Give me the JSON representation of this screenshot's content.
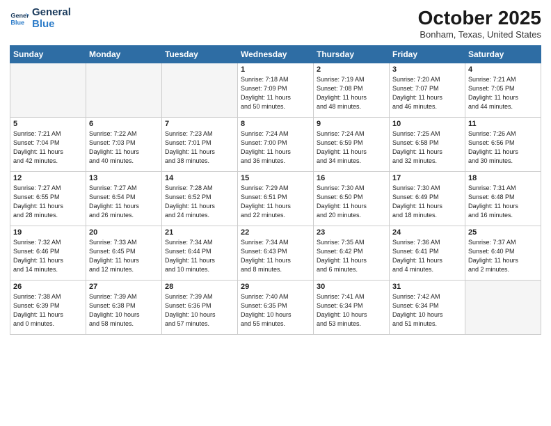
{
  "logo": {
    "line1": "General",
    "line2": "Blue"
  },
  "title": "October 2025",
  "location": "Bonham, Texas, United States",
  "weekdays": [
    "Sunday",
    "Monday",
    "Tuesday",
    "Wednesday",
    "Thursday",
    "Friday",
    "Saturday"
  ],
  "weeks": [
    [
      {
        "day": "",
        "info": ""
      },
      {
        "day": "",
        "info": ""
      },
      {
        "day": "",
        "info": ""
      },
      {
        "day": "1",
        "info": "Sunrise: 7:18 AM\nSunset: 7:09 PM\nDaylight: 11 hours\nand 50 minutes."
      },
      {
        "day": "2",
        "info": "Sunrise: 7:19 AM\nSunset: 7:08 PM\nDaylight: 11 hours\nand 48 minutes."
      },
      {
        "day": "3",
        "info": "Sunrise: 7:20 AM\nSunset: 7:07 PM\nDaylight: 11 hours\nand 46 minutes."
      },
      {
        "day": "4",
        "info": "Sunrise: 7:21 AM\nSunset: 7:05 PM\nDaylight: 11 hours\nand 44 minutes."
      }
    ],
    [
      {
        "day": "5",
        "info": "Sunrise: 7:21 AM\nSunset: 7:04 PM\nDaylight: 11 hours\nand 42 minutes."
      },
      {
        "day": "6",
        "info": "Sunrise: 7:22 AM\nSunset: 7:03 PM\nDaylight: 11 hours\nand 40 minutes."
      },
      {
        "day": "7",
        "info": "Sunrise: 7:23 AM\nSunset: 7:01 PM\nDaylight: 11 hours\nand 38 minutes."
      },
      {
        "day": "8",
        "info": "Sunrise: 7:24 AM\nSunset: 7:00 PM\nDaylight: 11 hours\nand 36 minutes."
      },
      {
        "day": "9",
        "info": "Sunrise: 7:24 AM\nSunset: 6:59 PM\nDaylight: 11 hours\nand 34 minutes."
      },
      {
        "day": "10",
        "info": "Sunrise: 7:25 AM\nSunset: 6:58 PM\nDaylight: 11 hours\nand 32 minutes."
      },
      {
        "day": "11",
        "info": "Sunrise: 7:26 AM\nSunset: 6:56 PM\nDaylight: 11 hours\nand 30 minutes."
      }
    ],
    [
      {
        "day": "12",
        "info": "Sunrise: 7:27 AM\nSunset: 6:55 PM\nDaylight: 11 hours\nand 28 minutes."
      },
      {
        "day": "13",
        "info": "Sunrise: 7:27 AM\nSunset: 6:54 PM\nDaylight: 11 hours\nand 26 minutes."
      },
      {
        "day": "14",
        "info": "Sunrise: 7:28 AM\nSunset: 6:52 PM\nDaylight: 11 hours\nand 24 minutes."
      },
      {
        "day": "15",
        "info": "Sunrise: 7:29 AM\nSunset: 6:51 PM\nDaylight: 11 hours\nand 22 minutes."
      },
      {
        "day": "16",
        "info": "Sunrise: 7:30 AM\nSunset: 6:50 PM\nDaylight: 11 hours\nand 20 minutes."
      },
      {
        "day": "17",
        "info": "Sunrise: 7:30 AM\nSunset: 6:49 PM\nDaylight: 11 hours\nand 18 minutes."
      },
      {
        "day": "18",
        "info": "Sunrise: 7:31 AM\nSunset: 6:48 PM\nDaylight: 11 hours\nand 16 minutes."
      }
    ],
    [
      {
        "day": "19",
        "info": "Sunrise: 7:32 AM\nSunset: 6:46 PM\nDaylight: 11 hours\nand 14 minutes."
      },
      {
        "day": "20",
        "info": "Sunrise: 7:33 AM\nSunset: 6:45 PM\nDaylight: 11 hours\nand 12 minutes."
      },
      {
        "day": "21",
        "info": "Sunrise: 7:34 AM\nSunset: 6:44 PM\nDaylight: 11 hours\nand 10 minutes."
      },
      {
        "day": "22",
        "info": "Sunrise: 7:34 AM\nSunset: 6:43 PM\nDaylight: 11 hours\nand 8 minutes."
      },
      {
        "day": "23",
        "info": "Sunrise: 7:35 AM\nSunset: 6:42 PM\nDaylight: 11 hours\nand 6 minutes."
      },
      {
        "day": "24",
        "info": "Sunrise: 7:36 AM\nSunset: 6:41 PM\nDaylight: 11 hours\nand 4 minutes."
      },
      {
        "day": "25",
        "info": "Sunrise: 7:37 AM\nSunset: 6:40 PM\nDaylight: 11 hours\nand 2 minutes."
      }
    ],
    [
      {
        "day": "26",
        "info": "Sunrise: 7:38 AM\nSunset: 6:39 PM\nDaylight: 11 hours\nand 0 minutes."
      },
      {
        "day": "27",
        "info": "Sunrise: 7:39 AM\nSunset: 6:38 PM\nDaylight: 10 hours\nand 58 minutes."
      },
      {
        "day": "28",
        "info": "Sunrise: 7:39 AM\nSunset: 6:36 PM\nDaylight: 10 hours\nand 57 minutes."
      },
      {
        "day": "29",
        "info": "Sunrise: 7:40 AM\nSunset: 6:35 PM\nDaylight: 10 hours\nand 55 minutes."
      },
      {
        "day": "30",
        "info": "Sunrise: 7:41 AM\nSunset: 6:34 PM\nDaylight: 10 hours\nand 53 minutes."
      },
      {
        "day": "31",
        "info": "Sunrise: 7:42 AM\nSunset: 6:34 PM\nDaylight: 10 hours\nand 51 minutes."
      },
      {
        "day": "",
        "info": ""
      }
    ]
  ]
}
